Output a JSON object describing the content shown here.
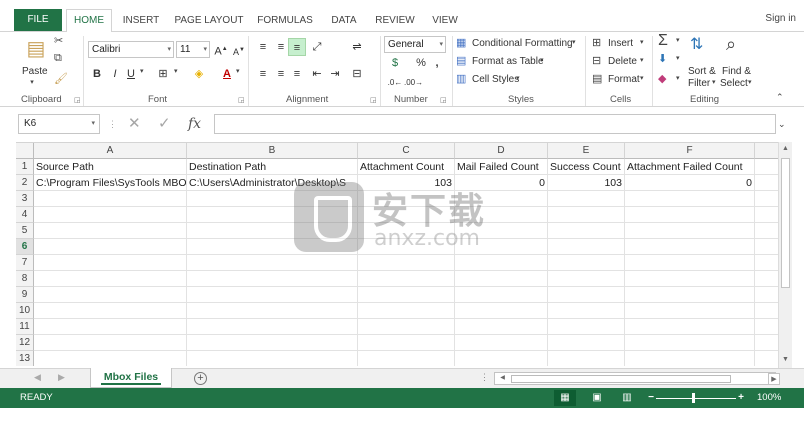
{
  "ribbon_tabs": [
    "FILE",
    "HOME",
    "INSERT",
    "PAGE LAYOUT",
    "FORMULAS",
    "DATA",
    "REVIEW",
    "VIEW"
  ],
  "signin": "Sign in",
  "clipboard": {
    "paste": "Paste",
    "label": "Clipboard"
  },
  "font": {
    "name": "Calibri",
    "size": "11",
    "label": "Font",
    "grow": "A",
    "shrink": "A",
    "bold": "B",
    "italic": "I",
    "underline": "U"
  },
  "alignment": {
    "label": "Alignment"
  },
  "number": {
    "format": "General",
    "label": "Number",
    "pct": "%",
    "comma": ","
  },
  "styles": {
    "conditional": "Conditional Formatting",
    "table": "Format as Table",
    "cell": "Cell Styles",
    "label": "Styles"
  },
  "cells": {
    "insert": "Insert",
    "delete": "Delete",
    "format": "Format",
    "label": "Cells"
  },
  "editing": {
    "sort": "Sort &",
    "filter": "Filter",
    "find": "Find &",
    "select": "Select",
    "label": "Editing"
  },
  "namebox": "K6",
  "fx": "fx",
  "columns": [
    "A",
    "B",
    "C",
    "D",
    "E",
    "F"
  ],
  "rows": [
    "1",
    "2",
    "3",
    "4",
    "5",
    "6",
    "7",
    "8",
    "9",
    "10",
    "11",
    "12",
    "13"
  ],
  "selected_row": "6",
  "header_row": [
    "Source Path",
    "Destination Path",
    "Attachment Count",
    "Mail Failed Count",
    "Success Count",
    "Attachment Failed Count"
  ],
  "data_row": [
    "C:\\Program Files\\SysTools MBOX",
    "C:\\Users\\Administrator\\Desktop\\S",
    "103",
    "0",
    "103",
    "0"
  ],
  "sheet_tab": "Mbox Files",
  "status": "READY",
  "zoom": "100%",
  "watermark": {
    "cn": "安下载",
    "en": "anxz.com"
  }
}
